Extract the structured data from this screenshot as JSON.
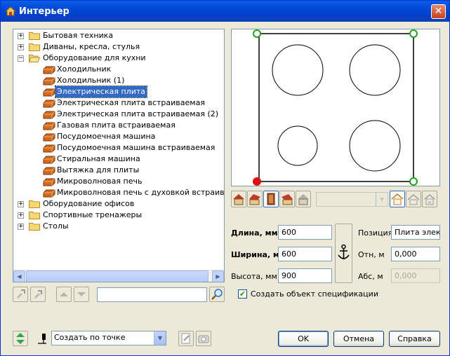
{
  "window": {
    "title": "Интерьер",
    "close_glyph": "✕"
  },
  "tree": {
    "items": [
      {
        "label": "Бытовая техника",
        "kind": "folder",
        "expanded": false
      },
      {
        "label": "Диваны, кресла, стулья",
        "kind": "folder",
        "expanded": false
      },
      {
        "label": "Оборудование для кухни",
        "kind": "folder",
        "expanded": true
      },
      {
        "label": "Холодильник",
        "kind": "item"
      },
      {
        "label": "Холодильник (1)",
        "kind": "item"
      },
      {
        "label": "Электрическая плита",
        "kind": "item",
        "selected": true
      },
      {
        "label": "Электрическая плита встраиваемая",
        "kind": "item"
      },
      {
        "label": "Электрическая плита встраиваемая (2)",
        "kind": "item"
      },
      {
        "label": "Газовая плита встраиваемая",
        "kind": "item"
      },
      {
        "label": "Посудомоечная машина",
        "kind": "item"
      },
      {
        "label": "Посудомоечная машина встраиваемая",
        "kind": "item"
      },
      {
        "label": "Стиральная машина",
        "kind": "item"
      },
      {
        "label": "Вытяжка для плиты",
        "kind": "item"
      },
      {
        "label": "Микроволновая печь",
        "kind": "item"
      },
      {
        "label": "Микроволновая печь с духовкой встраиваемые",
        "kind": "item"
      },
      {
        "label": "Оборудование офисов",
        "kind": "folder",
        "expanded": false
      },
      {
        "label": "Спортивные тренажеры",
        "kind": "folder",
        "expanded": false
      },
      {
        "label": "Столы",
        "kind": "folder",
        "expanded": false
      }
    ]
  },
  "search": {
    "value": ""
  },
  "view_combo": {
    "value": ""
  },
  "dimensions": {
    "length": {
      "label": "Длина, мм",
      "value": "600"
    },
    "width": {
      "label": "Ширина, мм",
      "value": "600"
    },
    "height": {
      "label": "Высота, мм",
      "value": "900"
    }
  },
  "position": {
    "position_label": "Позиция",
    "position_value": "Плита элект",
    "rel_label": "Отн, м",
    "rel_value": "0,000",
    "abs_label": "Абс, м",
    "abs_value": "0,000"
  },
  "spec_checkbox": {
    "label": "Создать объект спецификации",
    "checked": true,
    "check_glyph": "✔"
  },
  "create_mode": {
    "value": "Создать по точке"
  },
  "buttons": {
    "ok": "OK",
    "cancel": "Отмена",
    "help": "Справка"
  },
  "colors": {
    "title_bar": "#0147d6",
    "selection": "#316ac5",
    "handle_green": "#21a121",
    "handle_red": "#e01010",
    "item_icon": "#d2691e"
  },
  "icons": {
    "app": "house-icon",
    "folder": "folder-icon",
    "item": "furniture-item-icon",
    "anchor": "anchor-icon",
    "search": "magnifier-icon"
  }
}
